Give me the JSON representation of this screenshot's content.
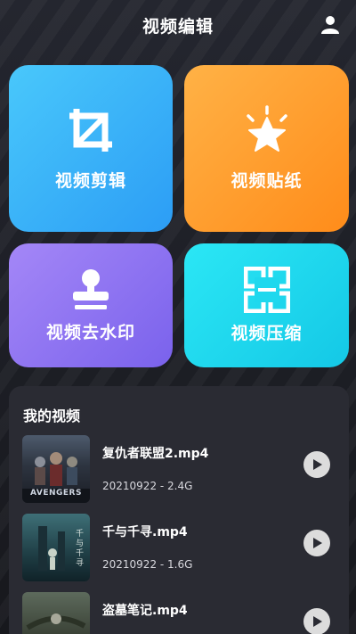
{
  "header": {
    "title": "视频编辑",
    "user_icon": "user-icon"
  },
  "tiles": [
    {
      "label": "视频剪辑",
      "icon": "crop-icon"
    },
    {
      "label": "视频贴纸",
      "icon": "star-sticker-icon"
    },
    {
      "label": "视频去水印",
      "icon": "stamp-icon"
    },
    {
      "label": "视频压缩",
      "icon": "compress-icon"
    }
  ],
  "my_videos": {
    "title": "我的视频",
    "items": [
      {
        "name": "复仇者联盟2.mp4",
        "meta": "20210922 - 2.4G",
        "thumb_text": "AVENGERS"
      },
      {
        "name": "千与千寻.mp4",
        "meta": "20210922 - 1.6G",
        "thumb_text": "千与千寻"
      },
      {
        "name": "盗墓笔记.mp4",
        "meta": "",
        "thumb_text": ""
      }
    ]
  },
  "colors": {
    "background": "#1b1c23",
    "tile_blue": "#3bb3f8",
    "tile_orange": "#ff9d2e",
    "tile_purple": "#8f74f2",
    "tile_cyan": "#1fd8ee",
    "panel": "#2a2b33"
  }
}
